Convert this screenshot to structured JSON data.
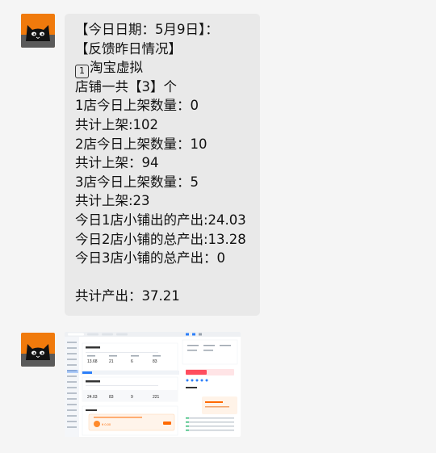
{
  "message": {
    "lines": [
      "【今日日期：5月9日】：",
      "【反馈昨日情况】",
      "淘宝虚拟",
      "店铺一共【3】个",
      "1店今日上架数量：0",
      "共计上架:102",
      "2店今日上架数量：10",
      "共计上架：94",
      "3店今日上架数量：5",
      "共计上架:23",
      "今日1店小铺出的产出:24.03",
      "今日2店小铺的总产出:13.28",
      "今日3店小铺的总产出：0",
      "",
      "共计产出：37.21"
    ],
    "keycap_label": "1"
  },
  "thumbnail": {
    "stats_top": [
      "13.68",
      "21",
      "6",
      "83"
    ],
    "stats_bottom": [
      "24.03",
      "83",
      "9",
      "221"
    ],
    "banner_text": "¥ 0.00"
  },
  "colors": {
    "background": "#f5f5f5",
    "bubble": "#e9e9e9",
    "accent_orange": "#ff6a00",
    "accent_blue": "#2d7ff9"
  },
  "icons": {
    "avatar": "black-cat-icon"
  }
}
